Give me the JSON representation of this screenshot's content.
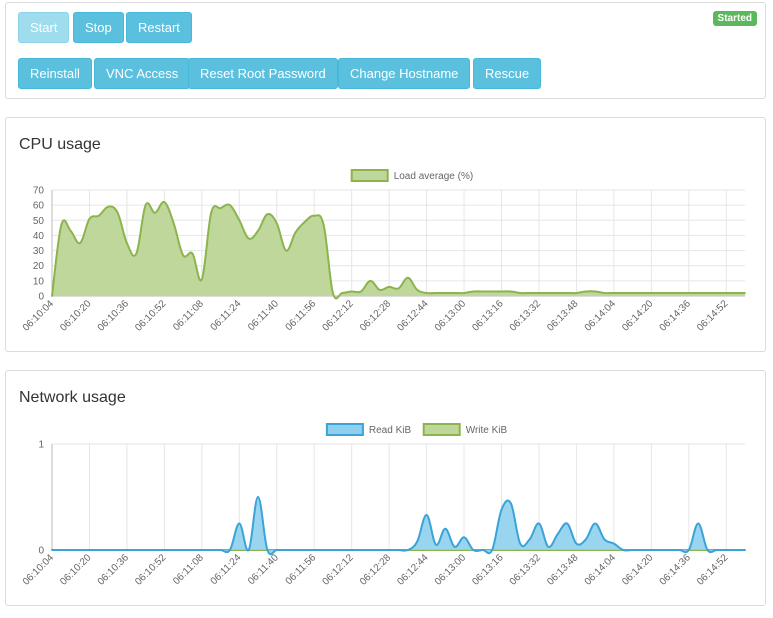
{
  "actions": {
    "status": "Started",
    "buttons": {
      "start": "Start",
      "stop": "Stop",
      "restart": "Restart",
      "reinstall": "Reinstall",
      "vnc": "VNC Access",
      "reset_root": "Reset Root Password",
      "change_hostname": "Change Hostname",
      "rescue": "Rescue"
    }
  },
  "cpu": {
    "title": "CPU usage"
  },
  "network": {
    "title": "Network usage"
  },
  "colors": {
    "info_button": "#5bc0de",
    "started_badge": "#5cb85c",
    "cpu_fill": "#bfd79a",
    "cpu_line": "#8cb44d",
    "read_fill": "#8fd0ee",
    "read_line": "#3aa3d8",
    "write_fill": "#bfd79a",
    "write_line": "#8cb44d"
  },
  "chart_data": [
    {
      "type": "area",
      "legend": [
        "Load average (%)"
      ],
      "ylim": [
        0,
        70
      ],
      "y_ticks": [
        0,
        10,
        20,
        30,
        40,
        50,
        60,
        70
      ],
      "x_tick_labels": [
        "06:10:04",
        "06:10:20",
        "06:10:36",
        "06:10:52",
        "06:11:08",
        "06:11:24",
        "06:11:40",
        "06:11:56",
        "06:12:12",
        "06:12:28",
        "06:12:44",
        "06:13:00",
        "06:13:16",
        "06:13:32",
        "06:13:48",
        "06:14:04",
        "06:14:20",
        "06:14:36",
        "06:14:52"
      ],
      "series": [
        {
          "name": "Load average (%)",
          "x": [
            "06:10:04",
            "06:10:08",
            "06:10:12",
            "06:10:16",
            "06:10:20",
            "06:10:24",
            "06:10:28",
            "06:10:32",
            "06:10:36",
            "06:10:40",
            "06:10:44",
            "06:10:48",
            "06:10:52",
            "06:10:56",
            "06:11:00",
            "06:11:04",
            "06:11:08",
            "06:11:12",
            "06:11:16",
            "06:11:20",
            "06:11:24",
            "06:11:28",
            "06:11:32",
            "06:11:36",
            "06:11:40",
            "06:11:44",
            "06:11:48",
            "06:11:52",
            "06:11:56",
            "06:12:00",
            "06:12:04",
            "06:12:08",
            "06:12:12",
            "06:12:16",
            "06:12:20",
            "06:12:24",
            "06:12:28",
            "06:12:32",
            "06:12:36",
            "06:12:40",
            "06:12:44",
            "06:12:48",
            "06:12:52",
            "06:12:56",
            "06:13:00",
            "06:13:04",
            "06:13:08",
            "06:13:12",
            "06:13:16",
            "06:13:20",
            "06:13:24",
            "06:13:28",
            "06:13:32",
            "06:13:36",
            "06:13:40",
            "06:13:44",
            "06:13:48",
            "06:13:52",
            "06:13:56",
            "06:14:00",
            "06:14:04",
            "06:14:08",
            "06:14:12",
            "06:14:16",
            "06:14:20",
            "06:14:24",
            "06:14:28",
            "06:14:32",
            "06:14:36",
            "06:14:40",
            "06:14:44",
            "06:14:48",
            "06:14:52",
            "06:14:56",
            "06:15:00"
          ],
          "values": [
            0,
            47,
            43,
            35,
            51,
            53,
            59,
            55,
            35,
            28,
            60,
            55,
            62,
            48,
            27,
            28,
            11,
            55,
            58,
            60,
            50,
            38,
            43,
            54,
            48,
            30,
            42,
            49,
            53,
            47,
            2,
            2,
            3,
            3,
            10,
            4,
            6,
            5,
            12,
            4,
            2,
            2,
            2,
            2,
            2,
            3,
            3,
            3,
            3,
            3,
            2,
            2,
            2,
            2,
            2,
            2,
            2,
            3,
            3,
            2,
            2,
            2,
            2,
            2,
            2,
            2,
            2,
            2,
            2,
            2,
            2,
            2,
            2,
            2,
            2
          ]
        }
      ]
    },
    {
      "type": "area",
      "legend": [
        "Read KiB",
        "Write KiB"
      ],
      "ylim": [
        0,
        1
      ],
      "y_ticks": [
        0,
        1
      ],
      "x_tick_labels": [
        "06:10:04",
        "06:10:20",
        "06:10:36",
        "06:10:52",
        "06:11:08",
        "06:11:24",
        "06:11:40",
        "06:11:56",
        "06:12:12",
        "06:12:28",
        "06:12:44",
        "06:13:00",
        "06:13:16",
        "06:13:32",
        "06:13:48",
        "06:14:04",
        "06:14:20",
        "06:14:36",
        "06:14:52"
      ],
      "series": [
        {
          "name": "Read KiB",
          "x": [
            "06:10:04",
            "06:10:08",
            "06:10:12",
            "06:10:16",
            "06:10:20",
            "06:10:24",
            "06:10:28",
            "06:10:32",
            "06:10:36",
            "06:10:40",
            "06:10:44",
            "06:10:48",
            "06:10:52",
            "06:10:56",
            "06:11:00",
            "06:11:04",
            "06:11:08",
            "06:11:12",
            "06:11:16",
            "06:11:20",
            "06:11:24",
            "06:11:28",
            "06:11:32",
            "06:11:36",
            "06:11:40",
            "06:11:44",
            "06:11:48",
            "06:11:52",
            "06:11:56",
            "06:12:00",
            "06:12:04",
            "06:12:08",
            "06:12:12",
            "06:12:16",
            "06:12:20",
            "06:12:24",
            "06:12:28",
            "06:12:32",
            "06:12:36",
            "06:12:40",
            "06:12:44",
            "06:12:48",
            "06:12:52",
            "06:12:56",
            "06:13:00",
            "06:13:04",
            "06:13:08",
            "06:13:12",
            "06:13:16",
            "06:13:20",
            "06:13:24",
            "06:13:28",
            "06:13:32",
            "06:13:36",
            "06:13:40",
            "06:13:44",
            "06:13:48",
            "06:13:52",
            "06:13:56",
            "06:14:00",
            "06:14:04",
            "06:14:08",
            "06:14:12",
            "06:14:16",
            "06:14:20",
            "06:14:24",
            "06:14:28",
            "06:14:32",
            "06:14:36",
            "06:14:40",
            "06:14:44",
            "06:14:48",
            "06:14:52",
            "06:14:56",
            "06:15:00"
          ],
          "values": [
            0,
            0,
            0,
            0,
            0,
            0,
            0,
            0,
            0,
            0,
            0,
            0,
            0,
            0,
            0,
            0,
            0,
            0,
            0,
            0,
            0.25,
            0,
            0.5,
            0,
            0,
            0,
            0,
            0,
            0,
            0,
            0,
            0,
            0,
            0,
            0,
            0,
            0,
            0,
            0,
            0.08,
            0.33,
            0.05,
            0.2,
            0.03,
            0.12,
            0,
            0,
            0,
            0.38,
            0.44,
            0.06,
            0.1,
            0.25,
            0.03,
            0.15,
            0.25,
            0.06,
            0.1,
            0.25,
            0.1,
            0.06,
            0,
            0,
            0,
            0,
            0,
            0,
            0,
            0,
            0.25,
            0,
            0,
            0,
            0,
            0
          ]
        },
        {
          "name": "Write KiB",
          "x": [
            "06:10:04",
            "06:15:00"
          ],
          "values": [
            0,
            0
          ]
        }
      ]
    }
  ]
}
